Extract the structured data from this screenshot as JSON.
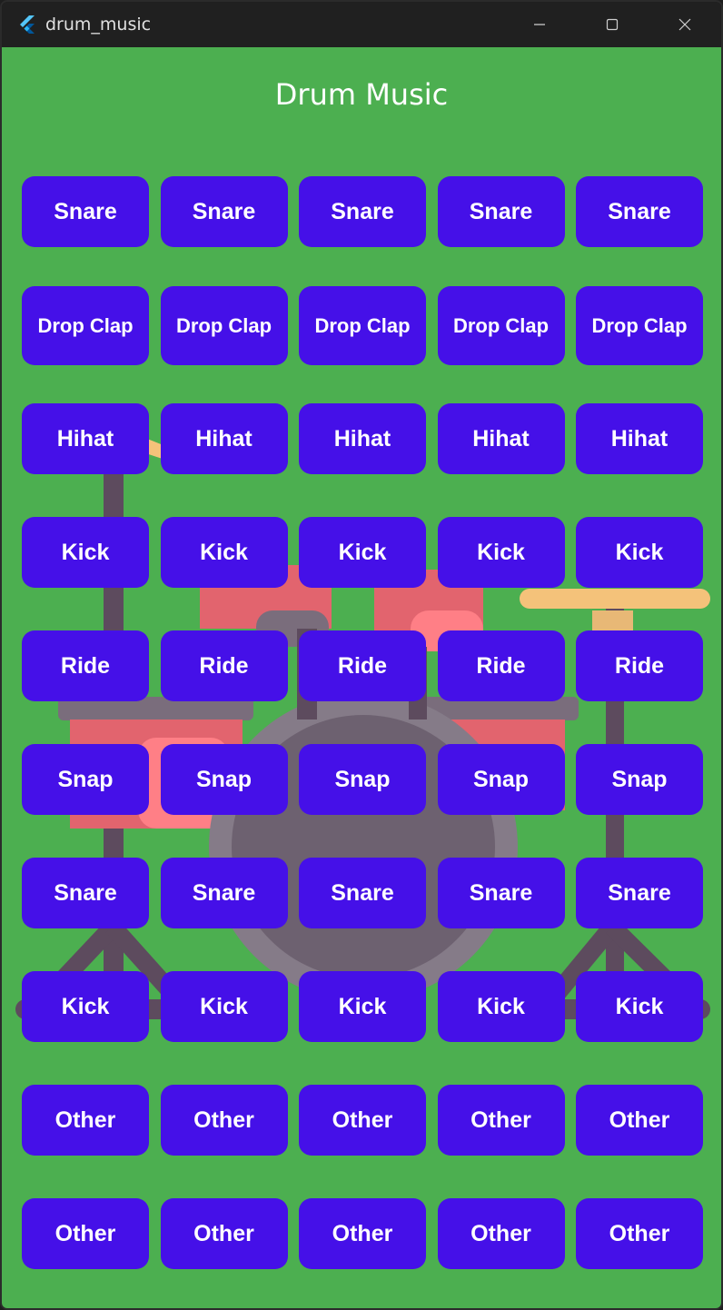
{
  "window": {
    "title": "drum_music",
    "minimize_icon": "minimize-icon",
    "maximize_icon": "maximize-icon",
    "close_icon": "close-icon"
  },
  "header": {
    "title": "Drum Music"
  },
  "rows": [
    {
      "label": "Snare"
    },
    {
      "label": "Drop Clap"
    },
    {
      "label": "Hihat"
    },
    {
      "label": "Kick"
    },
    {
      "label": "Ride"
    },
    {
      "label": "Snap"
    },
    {
      "label": "Snare"
    },
    {
      "label": "Kick"
    },
    {
      "label": "Other"
    },
    {
      "label": "Other"
    }
  ],
  "colors": {
    "background": "#4caf50",
    "pad": "#4510e8",
    "pad_text": "#ffffff"
  }
}
